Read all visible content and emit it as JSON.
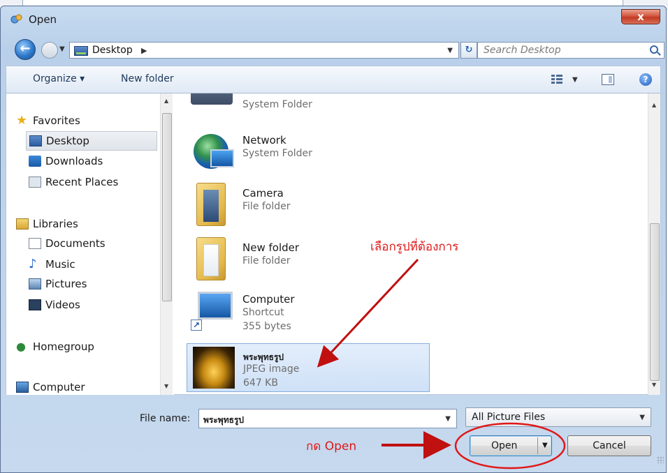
{
  "window": {
    "title": "Open",
    "close_glyph": "x"
  },
  "navigation": {
    "back_glyph": "←",
    "address_path": "Desktop",
    "refresh_glyph": "↻",
    "search_placeholder": "Search Desktop"
  },
  "toolbar": {
    "organize_label": "Organize ▾",
    "new_folder_label": "New folder",
    "help_glyph": "?"
  },
  "sidebar": {
    "items": [
      {
        "label": "Favorites",
        "icon": "star-icon"
      },
      {
        "label": "Desktop",
        "icon": "desktop-icon",
        "selected": true
      },
      {
        "label": "Downloads",
        "icon": "downloads-icon"
      },
      {
        "label": "Recent Places",
        "icon": "recent-places-icon"
      },
      {
        "label": "Libraries",
        "icon": "libraries-icon"
      },
      {
        "label": "Documents",
        "icon": "documents-icon"
      },
      {
        "label": "Music",
        "icon": "music-icon"
      },
      {
        "label": "Pictures",
        "icon": "pictures-icon"
      },
      {
        "label": "Videos",
        "icon": "videos-icon"
      },
      {
        "label": "Homegroup",
        "icon": "homegroup-icon"
      },
      {
        "label": "Computer",
        "icon": "computer-icon"
      }
    ]
  },
  "files": [
    {
      "name": "",
      "type": "System Folder",
      "size": ""
    },
    {
      "name": "Network",
      "type": "System Folder",
      "size": ""
    },
    {
      "name": "Camera",
      "type": "File folder",
      "size": ""
    },
    {
      "name": "New folder",
      "type": "File folder",
      "size": ""
    },
    {
      "name": "Computer",
      "type": "Shortcut",
      "size": "355 bytes"
    },
    {
      "name": "พระพุทธรูป",
      "type": "JPEG image",
      "size": "647 KB",
      "selected": true
    }
  ],
  "footer": {
    "file_name_label": "File name:",
    "file_name_value": "พระพุทธรูป",
    "file_type_filter": "All Picture Files",
    "open_label": "Open",
    "cancel_label": "Cancel"
  },
  "annotations": {
    "select_image_note": "เลือกรูปที่ต้องการ",
    "press_open_note": "กด Open",
    "color": "#e01818"
  },
  "colors": {
    "window_frame": "#c7dbf0",
    "selection": "#cfe1f7",
    "accent": "#3c7fb1"
  }
}
